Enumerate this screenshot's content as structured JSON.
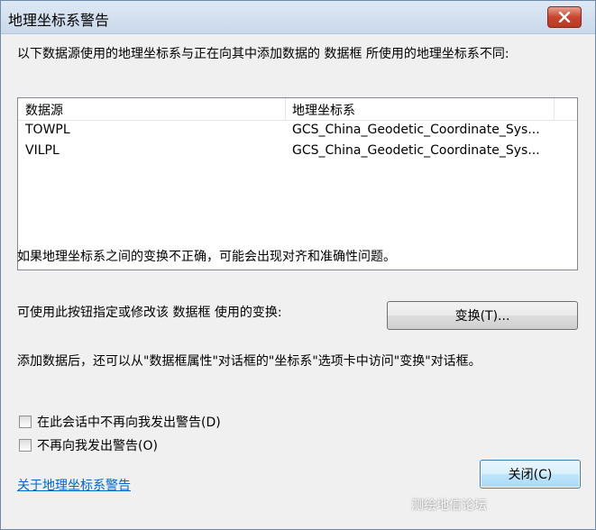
{
  "window": {
    "title": "地理坐标系警告"
  },
  "intro_text": "以下数据源使用的地理坐标系与正在向其中添加数据的 数据框 所使用的地理坐标系不同:",
  "table": {
    "columns": [
      "数据源",
      "地理坐标系"
    ],
    "rows": [
      {
        "source": "TOWPL",
        "gcs": "GCS_China_Geodetic_Coordinate_Sys..."
      },
      {
        "source": "VILPL",
        "gcs": "GCS_China_Geodetic_Coordinate_Sys..."
      }
    ]
  },
  "warning_text": "如果地理坐标系之间的变换不正确，可能会出现对齐和准确性问题。",
  "transform_label": "可使用此按钮指定或修改该 数据框 使用的变换:",
  "transform_button": "变换(T)...",
  "hint_text": "添加数据后，还可以从\"数据框属性\"对话框的\"坐标系\"选项卡中访问\"变换\"对话框。",
  "checkboxes": [
    {
      "label": "在此会话中不再向我发出警告(D)",
      "checked": false
    },
    {
      "label": "不再向我发出警告(O)",
      "checked": false
    }
  ],
  "help_link": "关于地理坐标系警告",
  "close_button": "关闭(C)",
  "watermark": "测绘地信论坛"
}
